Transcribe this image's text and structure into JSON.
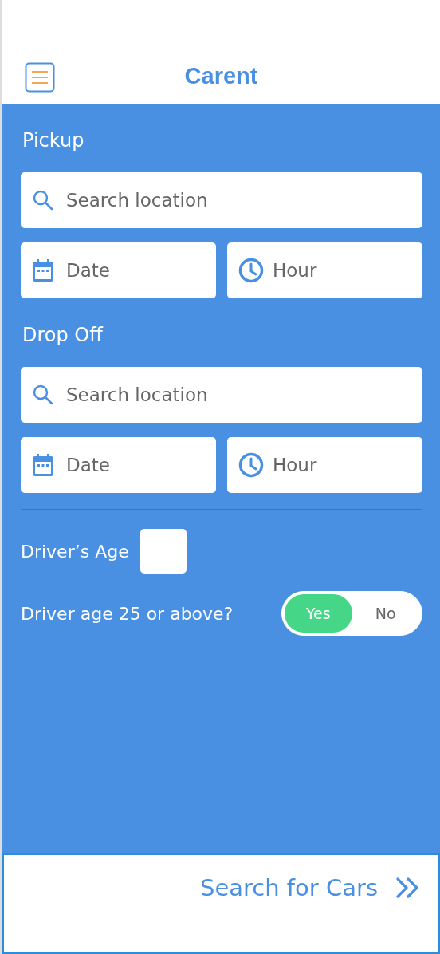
{
  "header": {
    "title": "Carent"
  },
  "sections": [
    {
      "label": "Pickup",
      "location": {
        "placeholder": "Search location"
      },
      "date": {
        "placeholder": "Date"
      },
      "hour": {
        "placeholder": "Hour"
      }
    },
    {
      "label": "Drop Off",
      "location": {
        "placeholder": "Search location"
      },
      "date": {
        "placeholder": "Date"
      },
      "hour": {
        "placeholder": "Hour"
      }
    }
  ],
  "age": {
    "label": "Driver’s Age"
  },
  "age_check": {
    "label": "Driver age 25 or above?",
    "options": [
      {
        "label": "Yes",
        "selected": true
      },
      {
        "label": "No",
        "selected": false
      }
    ]
  },
  "footer": {
    "button": "Search for Cars"
  }
}
